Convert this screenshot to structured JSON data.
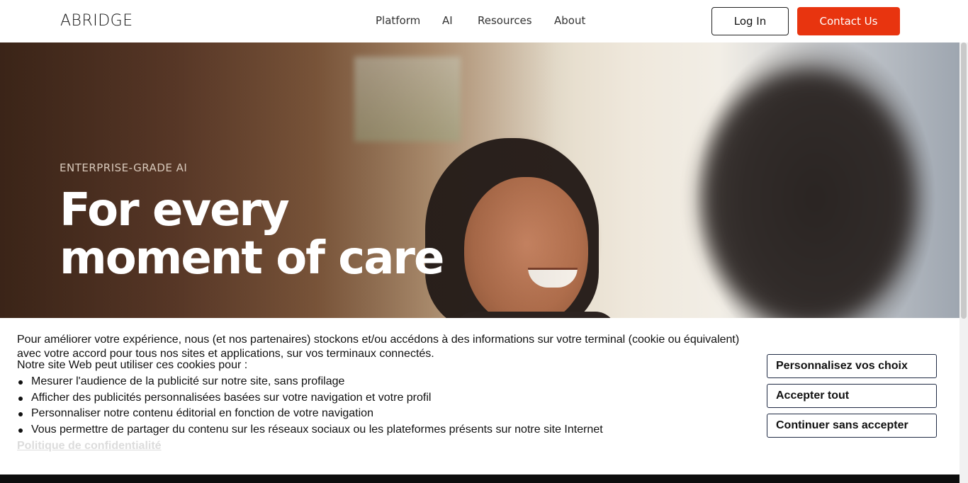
{
  "header": {
    "logo": "ABRIDGE",
    "nav": [
      "Platform",
      "AI",
      "Resources",
      "About"
    ],
    "login_label": "Log In",
    "contact_label": "Contact Us"
  },
  "hero": {
    "eyebrow": "ENTERPRISE-GRADE AI",
    "title_line1": "For every",
    "title_line2": "moment of care"
  },
  "cookie_banner": {
    "intro": "Pour améliorer votre expérience, nous (et nos partenaires) stockons et/ou accédons à des informations sur votre terminal (cookie ou équivalent) avec votre accord pour tous nos sites et applications, sur vos terminaux connectés.",
    "lead": "Notre site Web peut utiliser ces cookies pour :",
    "items": [
      "Mesurer l'audience de la publicité sur notre site, sans profilage",
      "Afficher des publicités personnalisées basées sur votre navigation et votre profil",
      "Personnaliser notre contenu éditorial en fonction de votre navigation",
      "Vous permettre de partager du contenu sur les réseaux sociaux ou les plateformes présents sur notre site Internet"
    ],
    "policy_link": "Politique de confidentialité",
    "buttons": {
      "customize": "Personnalisez vos choix",
      "accept": "Accepter tout",
      "decline": "Continuer sans accepter"
    }
  },
  "colors": {
    "accent": "#e8340f",
    "header_bg": "#ffffff",
    "banner_bg": "#ffffff",
    "button_border": "#1f2a44"
  }
}
